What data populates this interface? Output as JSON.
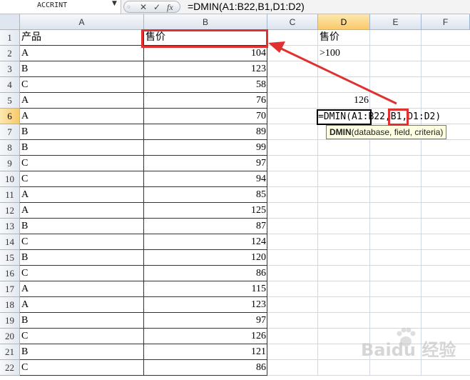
{
  "formula_bar": {
    "name_box": "ACCRINT",
    "fx_cancel": "✕",
    "fx_confirm": "✓",
    "fx_label": "fx",
    "formula": "=DMIN(A1:B22,B1,D1:D2)"
  },
  "columns": [
    "A",
    "B",
    "C",
    "D",
    "E",
    "F"
  ],
  "rows": [
    "1",
    "2",
    "3",
    "4",
    "5",
    "6",
    "7",
    "8",
    "9",
    "10",
    "11",
    "12",
    "13",
    "14",
    "15",
    "16",
    "17",
    "18",
    "19",
    "20",
    "21",
    "22"
  ],
  "table": {
    "header_a": "产品",
    "header_b": "售价",
    "data": [
      [
        "A",
        "104"
      ],
      [
        "B",
        "123"
      ],
      [
        "C",
        "58"
      ],
      [
        "A",
        "76"
      ],
      [
        "A",
        "70"
      ],
      [
        "B",
        "89"
      ],
      [
        "B",
        "99"
      ],
      [
        "C",
        "97"
      ],
      [
        "C",
        "94"
      ],
      [
        "A",
        "85"
      ],
      [
        "A",
        "125"
      ],
      [
        "B",
        "87"
      ],
      [
        "C",
        "124"
      ],
      [
        "B",
        "120"
      ],
      [
        "C",
        "86"
      ],
      [
        "A",
        "115"
      ],
      [
        "A",
        "123"
      ],
      [
        "B",
        "97"
      ],
      [
        "C",
        "126"
      ],
      [
        "B",
        "121"
      ],
      [
        "C",
        "86"
      ]
    ]
  },
  "criteria": {
    "header": "售价",
    "condition": ">100"
  },
  "result_cell": "126",
  "editing_formula": "=DMIN(A1:B22,B1,D1:D2)",
  "tooltip": {
    "function": "DMIN",
    "args": "(database, field, criteria)"
  },
  "watermark": "Baidu 经验",
  "colors": {
    "highlight": "#e03030",
    "gridline": "#d0d7e5",
    "header_bg": "#dde4ee",
    "active_header": "#f8c96a"
  }
}
